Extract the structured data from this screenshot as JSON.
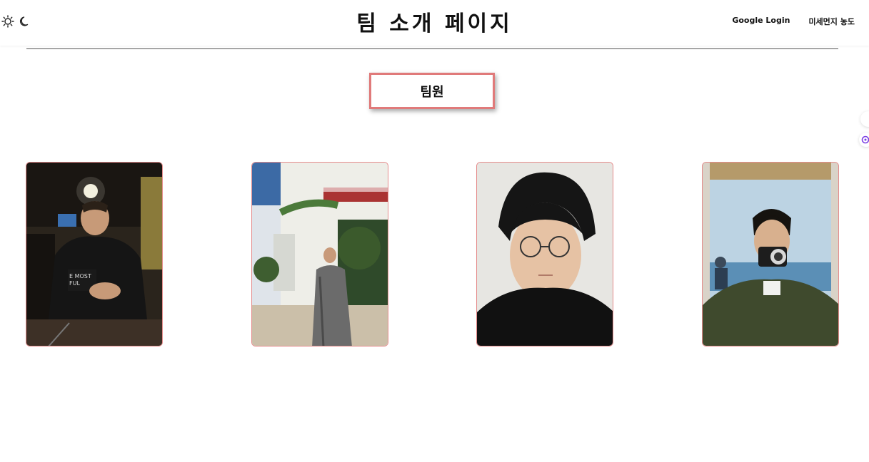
{
  "header": {
    "title": "팀 소개 페이지",
    "theme_icons": [
      "sun-icon",
      "moon-icon"
    ],
    "nav": [
      {
        "label": "Google Login"
      },
      {
        "label": "미세먼지 농도"
      }
    ]
  },
  "main": {
    "section_title": "팀원",
    "members": [
      {
        "photo": "member-photo-1"
      },
      {
        "photo": "member-photo-2"
      },
      {
        "photo": "member-photo-3"
      },
      {
        "photo": "member-photo-4"
      }
    ]
  },
  "colors": {
    "accent": "#e07a7a",
    "divider": "#555555",
    "text": "#111111"
  }
}
